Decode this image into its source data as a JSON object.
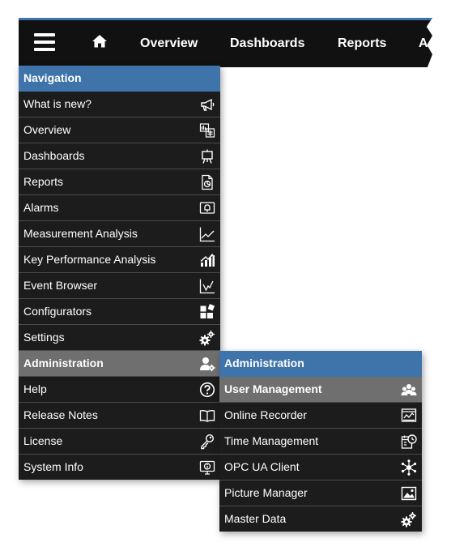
{
  "topbar": {
    "nav": [
      "Overview",
      "Dashboards",
      "Reports",
      "A"
    ],
    "icons": {
      "menu": "hamburger-icon",
      "home": "home-icon"
    }
  },
  "main_menu": {
    "items": [
      {
        "label": "Navigation",
        "icon": ""
      },
      {
        "label": "What is new?",
        "icon": "megaphone-icon"
      },
      {
        "label": "Overview",
        "icon": "overview-icon"
      },
      {
        "label": "Dashboards",
        "icon": "easel-icon"
      },
      {
        "label": "Reports",
        "icon": "report-icon"
      },
      {
        "label": "Alarms",
        "icon": "alarm-icon"
      },
      {
        "label": "Measurement Analysis",
        "icon": "line-chart-icon"
      },
      {
        "label": "Key Performance Analysis",
        "icon": "bar-chart-icon"
      },
      {
        "label": "Event Browser",
        "icon": "event-chart-icon"
      },
      {
        "label": "Configurators",
        "icon": "blocks-icon"
      },
      {
        "label": "Settings",
        "icon": "gears-icon"
      },
      {
        "label": "Administration",
        "icon": "user-admin-icon"
      },
      {
        "label": "Help",
        "icon": "help-icon"
      },
      {
        "label": "Release Notes",
        "icon": "book-icon"
      },
      {
        "label": "License",
        "icon": "key-icon"
      },
      {
        "label": "System Info",
        "icon": "monitor-info-icon"
      }
    ]
  },
  "sub_menu": {
    "items": [
      {
        "label": "Administration",
        "icon": ""
      },
      {
        "label": "User Management",
        "icon": "users-icon"
      },
      {
        "label": "Online Recorder",
        "icon": "recorder-icon"
      },
      {
        "label": "Time Management",
        "icon": "calendar-clock-icon"
      },
      {
        "label": "OPC UA Client",
        "icon": "network-icon"
      },
      {
        "label": "Picture Manager",
        "icon": "picture-icon"
      },
      {
        "label": "Master Data",
        "icon": "gears-icon"
      }
    ]
  },
  "colors": {
    "header_blue": "#3f74ab",
    "menu_bg": "#1c1c1c",
    "active_gray": "#6f6f6f",
    "topbar_bg": "#111111"
  }
}
